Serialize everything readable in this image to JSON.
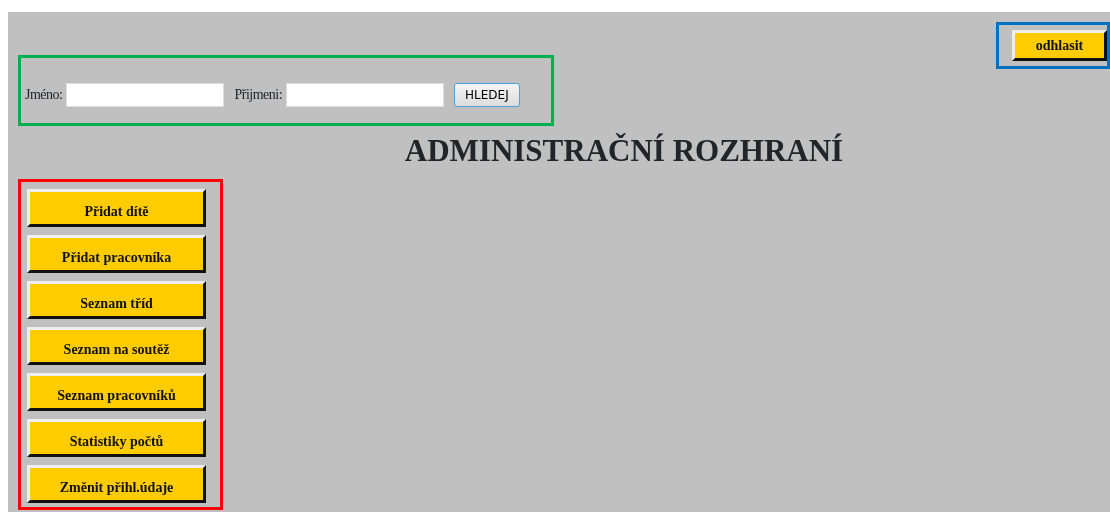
{
  "logout_button": "odhlasit",
  "search": {
    "fields": [
      {
        "label": "Jméno:"
      },
      {
        "label": "Přijmeni:"
      }
    ],
    "button": "HLEDEJ"
  },
  "title": "ADMINISTRAČNÍ ROZHRANÍ",
  "menu": [
    "Přidat dítě",
    "Přidat pracovníka",
    "Seznam tříd",
    "Seznam na soutěž",
    "Seznam pracovníků",
    "Statistiky počtů",
    "Změnit přihl.údaje"
  ]
}
